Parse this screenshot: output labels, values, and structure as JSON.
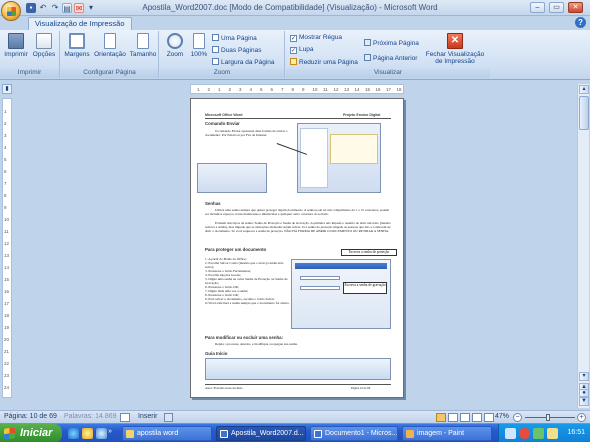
{
  "window": {
    "title": "Apostila_Word2007.doc [Modo de Compatibilidade] (Visualização) - Microsoft Word"
  },
  "ribbon": {
    "tab": "Visualização de Impressão",
    "groups": {
      "imprimir": {
        "label": "Imprimir",
        "buttons": [
          "Imprimir",
          "Opções"
        ]
      },
      "configurar": {
        "label": "Configurar Página",
        "buttons": [
          "Margens",
          "Orientação",
          "Tamanho"
        ]
      },
      "zoom": {
        "label": "Zoom",
        "buttons": [
          "Zoom",
          "100%"
        ],
        "small": [
          "Uma Página",
          "Duas Páginas",
          "Largura da Página"
        ]
      },
      "visualizar": {
        "label": "Visualizar",
        "checks": [
          "Mostrar Régua",
          "Lupa",
          "Reduzir uma Página"
        ],
        "nav": [
          "Próxima Página",
          "Página Anterior"
        ],
        "close": "Fechar Visualização de Impressão"
      }
    }
  },
  "ruler": {
    "h_ticks": [
      "1",
      "2",
      "1",
      "2",
      "3",
      "4",
      "5",
      "6",
      "7",
      "8",
      "9",
      "10",
      "11",
      "12",
      "13",
      "14",
      "15",
      "16",
      "17",
      "18"
    ],
    "v_ticks": [
      "1",
      "2",
      "3",
      "4",
      "5",
      "6",
      "7",
      "8",
      "9",
      "10",
      "11",
      "12",
      "13",
      "14",
      "15",
      "16",
      "17",
      "18",
      "19",
      "20",
      "21",
      "22",
      "23",
      "24"
    ]
  },
  "page": {
    "header_left": "Microsoft Office Word",
    "header_right": "Projeto Ensino Digital",
    "heading1": "Comando Enviar",
    "para1": "O comando Enviar apresenta duas formas de enviar o documento: Por Email ou por Fax da Internet.",
    "heading2": "Senhas",
    "para2": "Utilize uma senha sempre que quiser proteger algum documento. A senha pode ter um comprimento de 1 a 15 caracteres, podem ser incluídos espaços, letras maiúsculas e minúsculas e qualquer outro caractere do teclado.",
    "para3": "Existem dois tipos de senha: Senha de Proteção e Senha de Gravação. A primeira não impede o usuário de abrir um texto (mesmo sem ter a senha), mas impede que as alterações efetuadas sejam salvas. Já a senha de proteção impede as pessoas que não a conhecem de abrir o documento. Se você esquecer a senha de proteção, NÃO HÁ FORMA DE ABRIR O DOCUMENTO OU RETIRAR A SENHA.",
    "heading3": "Para proteger um documento",
    "steps": [
      "1. A partir do Botão do Office;",
      "2. Escolha Salvar Como (mesmo que o texto já tenha sido salvo);",
      "3. Pressione o botão Ferramentas;",
      "4. Escolha Opções Gerais;",
      "5. Digite uma senha na caixa Senha de Proteção ou Senha de Gravação;",
      "6. Pressione o botão OK;",
      "7. Digite mais uma vez a senha;",
      "8. Pressione o botão OK;",
      "9. Para salvar o documento, escolha o botão Salvar.",
      "O Word solicitará a senha sempre que o documento for aberto."
    ],
    "callout1": "Escreva a senha de proteção",
    "callout2": "Escreva a senha de gravação",
    "heading4": "Para modificar ou excluir uma senha:",
    "para4": "Repita o processo anterior, e modifique ou apague sua senha.",
    "heading5": "Guia Início",
    "footer_left": "Autor: Everaldo Jesus dos Reis",
    "footer_right": "Página 10 de 69"
  },
  "status": {
    "page": "Página: 10 de 69",
    "words": "Palavras: 14.869",
    "mode": "Inserir",
    "zoom": "47%"
  },
  "taskbar": {
    "start": "Iniciar",
    "tasks": [
      "apostila word",
      "Apostila_Word2007.d...",
      "Documento1 - Micros...",
      "imagem - Paint"
    ],
    "clock": "16:51"
  },
  "colors": {
    "ribbon_text": "#15428b",
    "taskbar": "#2658c8",
    "start_green": "#3f9c36"
  }
}
